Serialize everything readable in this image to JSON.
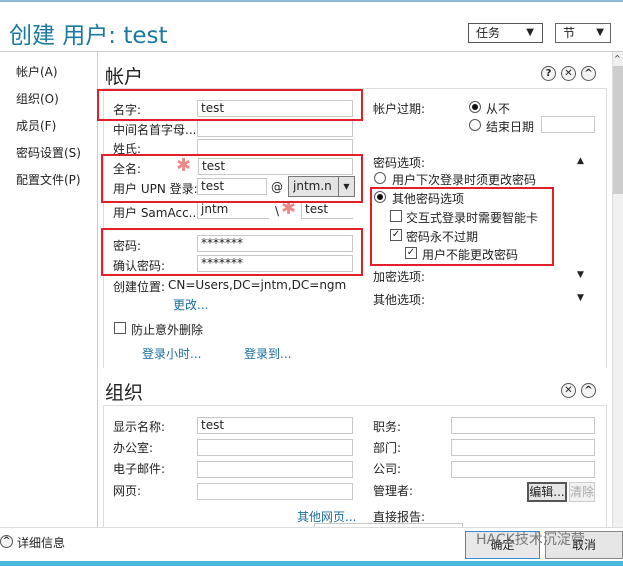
{
  "window": {
    "title": "创建 用户: test",
    "tasks_label": "任务",
    "sections_label": "节"
  },
  "nav": {
    "items": [
      {
        "label": "帐户(A)"
      },
      {
        "label": "组织(O)"
      },
      {
        "label": "成员(F)"
      },
      {
        "label": "密码设置(S)"
      },
      {
        "label": "配置文件(P)"
      }
    ]
  },
  "account": {
    "title": "帐户",
    "first_name": {
      "label": "名字:",
      "value": "test"
    },
    "middle_initials": {
      "label": "中间名首字母...",
      "value": ""
    },
    "last_name": {
      "label": "姓氏:",
      "value": ""
    },
    "full_name": {
      "label": "全名:",
      "value": "test"
    },
    "upn": {
      "label": "用户 UPN 登录:",
      "value": "test",
      "at": "@",
      "domain": "jntm.n"
    },
    "sam": {
      "label": "用户 SamAcc...",
      "domain": "jntm",
      "sep": "\\",
      "value": "test"
    },
    "password": {
      "label": "密码:",
      "value": "*******"
    },
    "confirm_password": {
      "label": "确认密码:",
      "value": "*******"
    },
    "create_in": {
      "label": "创建位置:",
      "value": "CN=Users,DC=jntm,DC=ngm",
      "change_link": "更改..."
    },
    "protect": {
      "label": "防止意外删除",
      "checked": false
    },
    "logon_hours": "登录小时...",
    "logon_to": "登录到...",
    "expires": {
      "label": "帐户过期:",
      "never": "从不",
      "end_date": "结束日期",
      "end_date_value": "",
      "selected": "never"
    },
    "password_options": {
      "label": "密码选项:",
      "must_change": "用户下次登录时须更改密码",
      "other": "其他密码选项",
      "selected": "other",
      "smartcard": {
        "label": "交互式登录时需要智能卡",
        "checked": false
      },
      "never_expires": {
        "label": "密码永不过期",
        "checked": true
      },
      "cannot_change": {
        "label": "用户不能更改密码",
        "checked": true
      }
    },
    "encryption_options": "加密选项:",
    "other_options": "其他选项:"
  },
  "org": {
    "title": "组织",
    "display_name": {
      "label": "显示名称:",
      "value": "test"
    },
    "office": {
      "label": "办公室:",
      "value": ""
    },
    "email": {
      "label": "电子邮件:",
      "value": ""
    },
    "webpage": {
      "label": "网页:",
      "value": ""
    },
    "other_webpages": "其他网页...",
    "job_title": {
      "label": "职务:",
      "value": ""
    },
    "department": {
      "label": "部门:",
      "value": ""
    },
    "company": {
      "label": "公司:",
      "value": ""
    },
    "manager": {
      "label": "管理者:",
      "edit": "编辑...",
      "clear": "清除"
    },
    "direct_reports": {
      "label": "直接报告:"
    }
  },
  "footer": {
    "details": "详细信息",
    "ok": "确定",
    "cancel": "取消",
    "watermark": "HACK技术沉淀营"
  },
  "colors": {
    "title": "#1a7aa0",
    "highlight": "#e3202a",
    "link": "#1a6fa0"
  }
}
